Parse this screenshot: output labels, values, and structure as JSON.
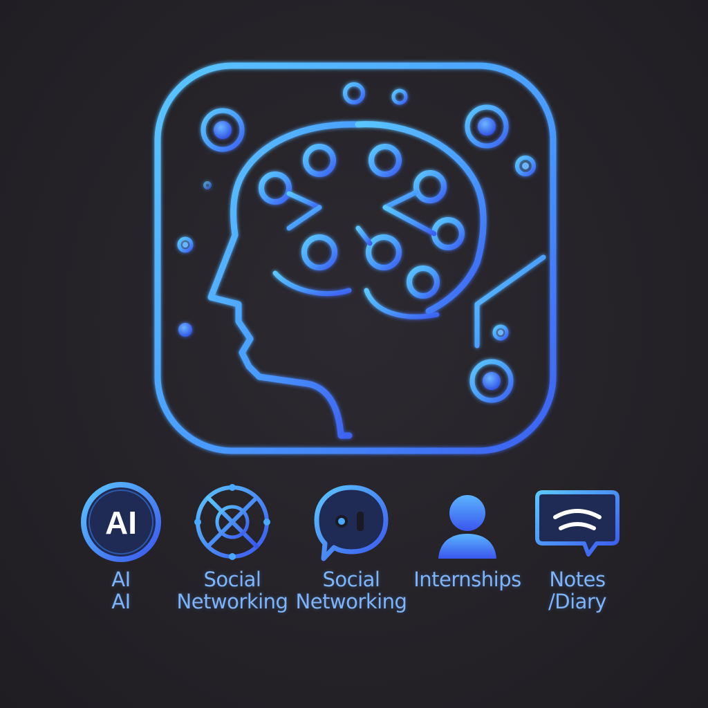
{
  "logo": {
    "name": "ai-brain-circuit-logo"
  },
  "icons": [
    {
      "id": "ai",
      "icon_name": "ai-badge-icon",
      "icon_text": "AI",
      "label_line1": "AI",
      "label_line2": "AI"
    },
    {
      "id": "social1",
      "icon_name": "network-wheel-icon",
      "label_line1": "Social",
      "label_line2": "Networking"
    },
    {
      "id": "social2",
      "icon_name": "chat-bubble-icon",
      "label_line1": "Social",
      "label_line2": "Networking"
    },
    {
      "id": "internships",
      "icon_name": "person-icon",
      "label_line1": "Internships",
      "label_line2": ""
    },
    {
      "id": "notes",
      "icon_name": "message-wave-icon",
      "label_line1": "Notes",
      "label_line2": "/Diary"
    }
  ],
  "colors": {
    "accent": "#4aa8ff",
    "accent_dark": "#3a6ef0",
    "background": "#262428",
    "label": "#7fb4f8"
  }
}
